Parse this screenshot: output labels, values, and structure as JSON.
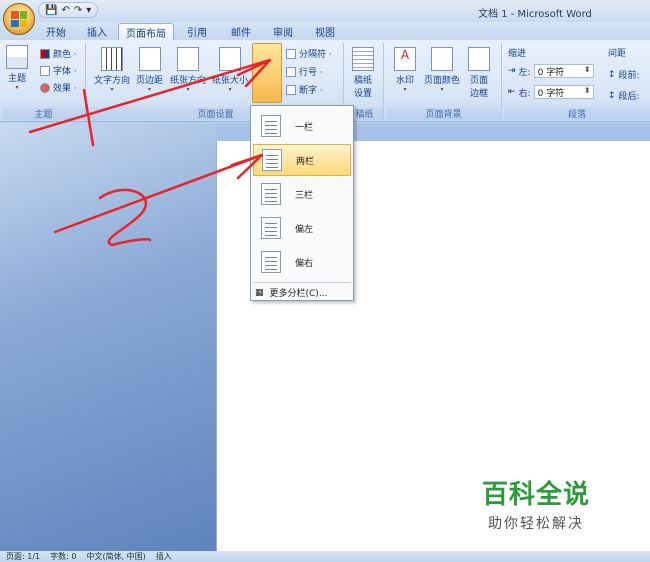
{
  "window_title": "文档 1 - Microsoft Word",
  "qat": [
    "💾",
    "↶",
    "↷",
    "▾"
  ],
  "tabs": [
    "开始",
    "插入",
    "页面布局",
    "引用",
    "邮件",
    "审阅",
    "视图"
  ],
  "ribbon": {
    "theme_group": {
      "label": "主题",
      "theme_btn": "主题",
      "colors": "颜色 ·",
      "fonts": "字体 ·",
      "effects": "效果 ·"
    },
    "page_setup": {
      "label": "页面设置",
      "text_direction": "文字方向",
      "margins": "页边距",
      "orientation": "纸张方向",
      "size": "纸张大小",
      "columns": "分栏",
      "breaks": "分隔符 ·",
      "line_numbers": "行号 ·",
      "hyphenation": "断字 ·"
    },
    "manuscript": {
      "label": "稿纸",
      "btn_line1": "稿纸",
      "btn_line2": "设置"
    },
    "background": {
      "label": "页面背景",
      "watermark": "水印",
      "page_color": "页面颜色",
      "page_border_1": "页面",
      "page_border_2": "边框"
    },
    "paragraph": {
      "label": "段落",
      "indent_title": "缩进",
      "spacing_title": "间距",
      "left_label": "左:",
      "left_value": "0 字符",
      "right_label": "右:",
      "right_value": "0 字符",
      "before_label": "段前:",
      "after_label": "段后:"
    }
  },
  "columns_menu": {
    "items": [
      "一栏",
      "两栏",
      "三栏",
      "偏左",
      "偏右"
    ],
    "highlighted_index": 1,
    "more": "更多分栏(C)..."
  },
  "status_bar": [
    "页面: 1/1",
    "字数: 0",
    "中文(简体, 中国)",
    "插入"
  ],
  "watermark": {
    "title": "百科全说",
    "subtitle": "助你轻松解决"
  },
  "colors": {
    "annotation": "#e8232a",
    "watermark_green": "#2e9a3a"
  }
}
